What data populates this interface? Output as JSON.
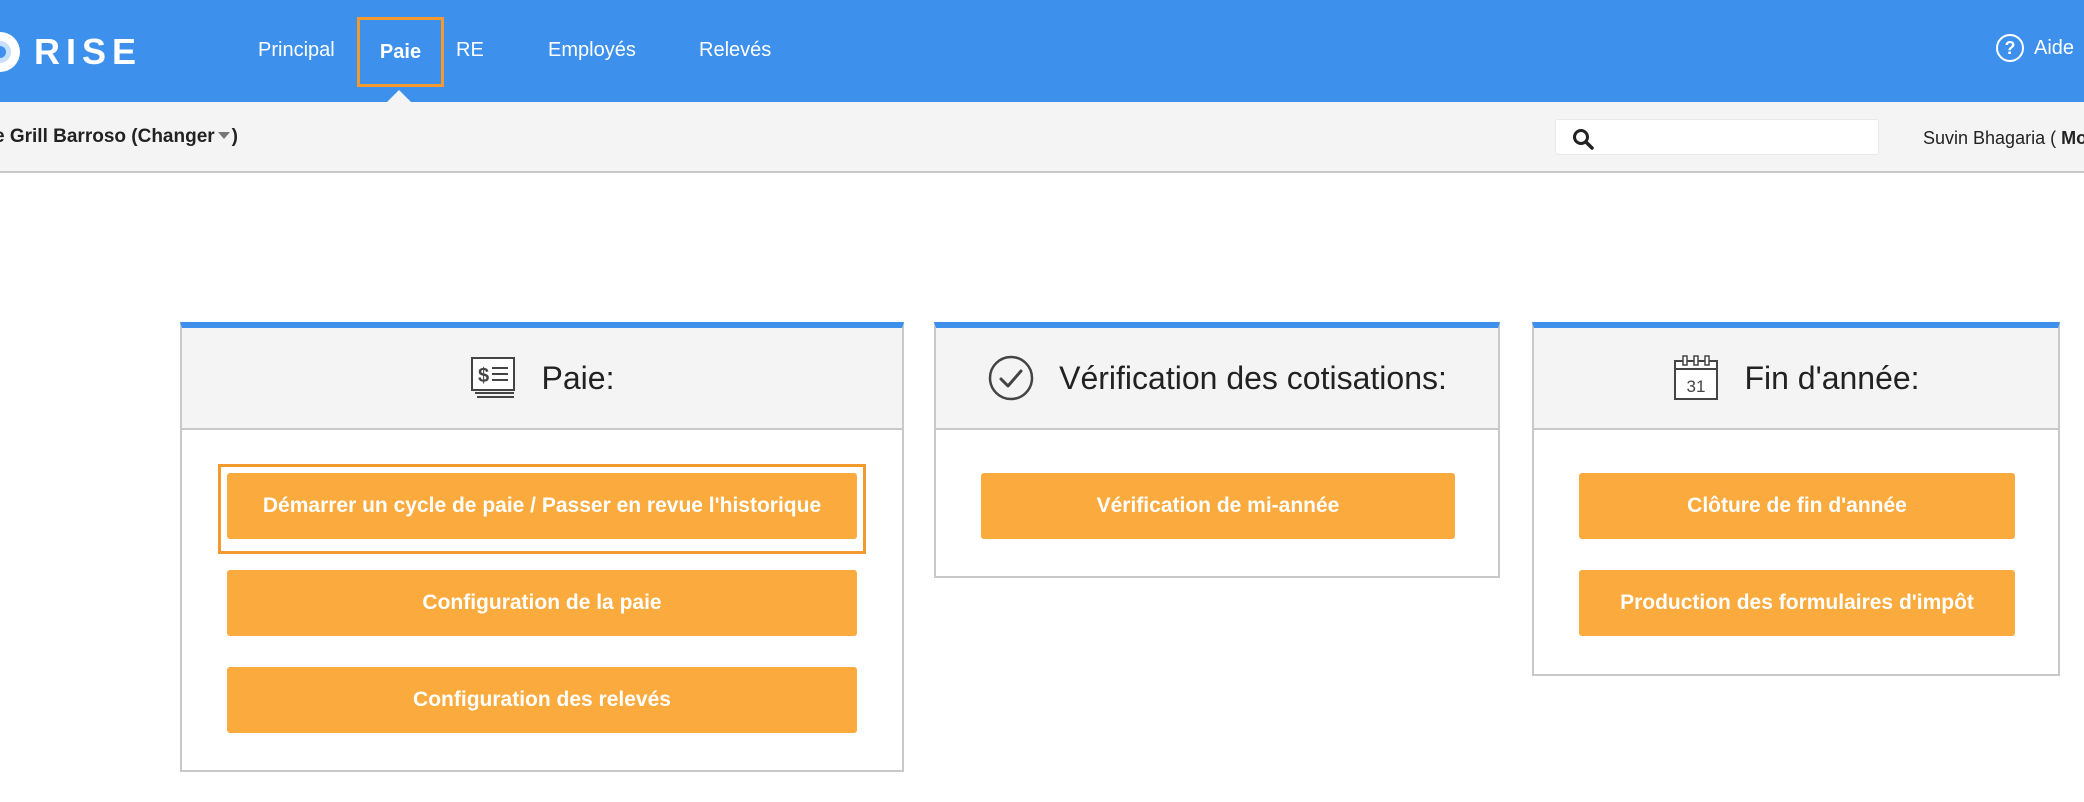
{
  "brand": {
    "name": "RISE"
  },
  "nav": {
    "items": [
      "Principal",
      "Paie",
      "RE",
      "Employés",
      "Relevés"
    ],
    "active": "Paie",
    "help_label": "Aide"
  },
  "subbar": {
    "company": "e Grill Barroso (Changer",
    "company_close": ")",
    "search_placeholder": "",
    "user_name": "Suvin Bhagaria (",
    "user_suffix": "Mo"
  },
  "cards": {
    "paie": {
      "title": "Paie:",
      "icon": "payroll-check-icon",
      "buttons": [
        "Démarrer un cycle de paie / Passer en revue l'historique",
        "Configuration de la paie",
        "Configuration des relevés"
      ]
    },
    "verification": {
      "title": "Vérification des cotisations:",
      "icon": "checkmark-circle-icon",
      "buttons": [
        "Vérification de mi-année"
      ]
    },
    "fin_annee": {
      "title": "Fin d'année:",
      "icon": "calendar-icon",
      "calendar_day": "31",
      "buttons": [
        "Clôture de fin d'année",
        "Production des formulaires d'impôt"
      ]
    }
  },
  "colors": {
    "topbar": "#3d91ec",
    "accent_orange": "#fbab3d",
    "highlight": "#f39a2e"
  }
}
